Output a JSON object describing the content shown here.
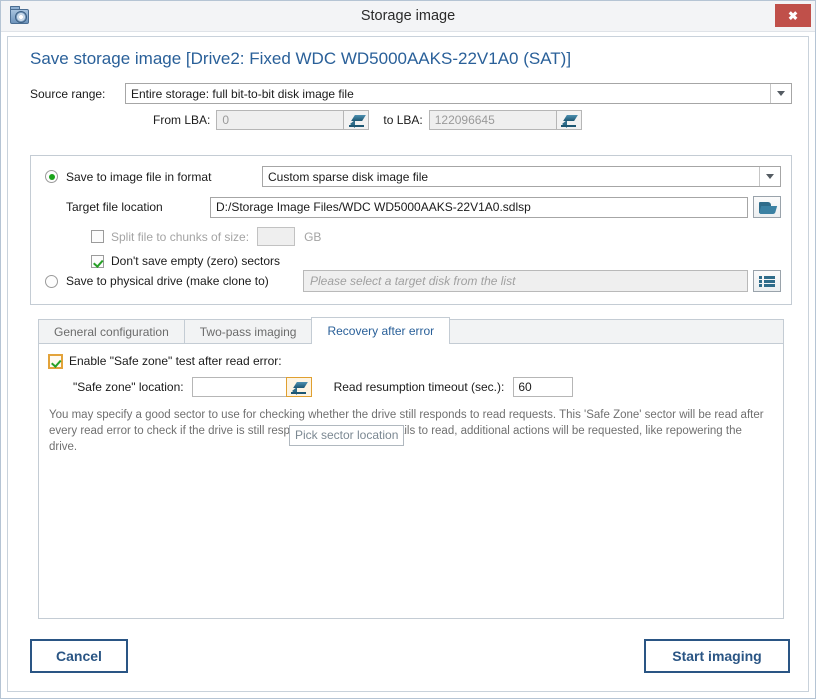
{
  "window": {
    "title": "Storage image",
    "app_icon": "disc-folder-icon",
    "close_label": "✖"
  },
  "page_title": "Save storage image [Drive2: Fixed WDC WD5000AAKS-22V1A0 (SAT)]",
  "source": {
    "label": "Source range:",
    "range_value": "Entire storage: full bit-to-bit disk image file",
    "from_lba_label": "From LBA:",
    "from_lba_value": "0",
    "to_lba_label": "to LBA:",
    "to_lba_value": "122096645",
    "edit_icon": "pencil-icon"
  },
  "destination": {
    "save_to_file_label": "Save to image file in format",
    "format_value": "Custom sparse disk image file",
    "target_label": "Target file location",
    "target_value": "D:/Storage Image Files/WDC WD5000AAKS-22V1A0.sdlsp",
    "browse_icon": "folder-open-icon",
    "split_label": "Split file to chunks of size:",
    "split_value": "",
    "split_units": "GB",
    "no_empty_label": "Don't save empty (zero) sectors",
    "clone_label": "Save to physical drive (make clone to)",
    "clone_placeholder": "Please select a target disk from the list",
    "clone_icon": "list-select-icon"
  },
  "tabs": [
    {
      "label": "General configuration",
      "active": false
    },
    {
      "label": "Two-pass imaging",
      "active": false
    },
    {
      "label": "Recovery after error",
      "active": true
    }
  ],
  "recovery": {
    "enable_label": "Enable \"Safe zone\" test after read error:",
    "safezone_label": "\"Safe zone\" location:",
    "safezone_value": "",
    "safezone_edit_icon": "pencil-icon",
    "tooltip": "Pick sector location",
    "timeout_label": "Read resumption timeout (sec.):",
    "timeout_value": "60",
    "description": "You may specify a good sector to use for checking whether the drive still responds to read requests. This 'Safe Zone' sector will be read after every read error to check if the drive is still responsive. If this sector fails to read, additional actions will be requested, like repowering the drive."
  },
  "footer": {
    "cancel_label": "Cancel",
    "start_label": "Start imaging"
  },
  "colors": {
    "accent_blue": "#2a6099",
    "button_blue": "#2a5584",
    "close_red": "#c0504a",
    "check_green": "#19a319",
    "focus_orange": "#e3a33a",
    "icon_teal": "#2f6c8a"
  }
}
